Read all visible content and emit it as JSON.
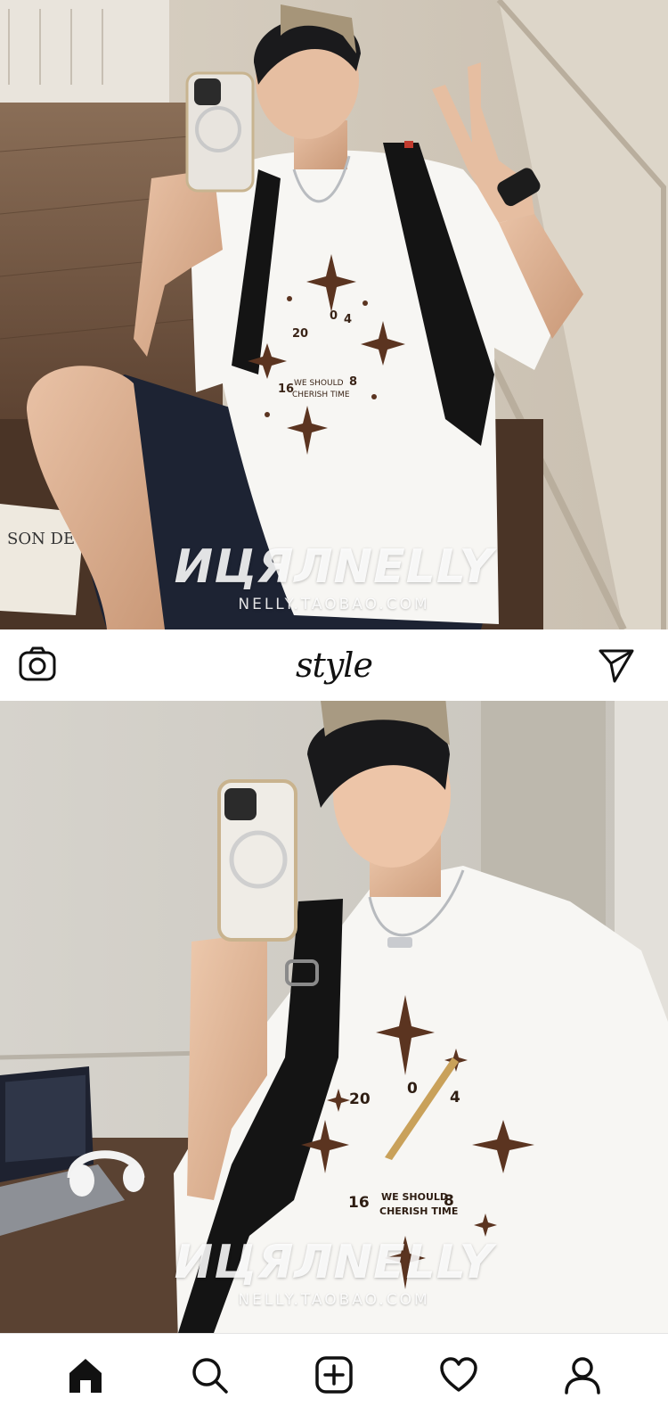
{
  "header": {
    "title": "style",
    "left_icon": "camera-icon",
    "right_icon": "send-icon"
  },
  "watermark": {
    "logo": "ИЦЯЛNELLY",
    "url": "NELLY.TAOBAO.COM"
  },
  "shirt_print": {
    "slogan_line1": "WE SHOULD",
    "slogan_line2": "CHERISH TIME",
    "numbers": [
      "20",
      "0",
      "4",
      "16",
      "8"
    ]
  },
  "bottom_nav": {
    "items": [
      {
        "name": "home",
        "icon": "home-icon",
        "active": true
      },
      {
        "name": "search",
        "icon": "search-icon",
        "active": false
      },
      {
        "name": "add",
        "icon": "add-post-icon",
        "active": false
      },
      {
        "name": "activity",
        "icon": "heart-icon",
        "active": false
      },
      {
        "name": "profile",
        "icon": "profile-icon",
        "active": false
      }
    ]
  },
  "colors": {
    "accent": "#111111",
    "shirt": "#f7f6f3",
    "embroidery": "#5b3420",
    "shorts": "#1d2333",
    "bag": "#141414"
  }
}
